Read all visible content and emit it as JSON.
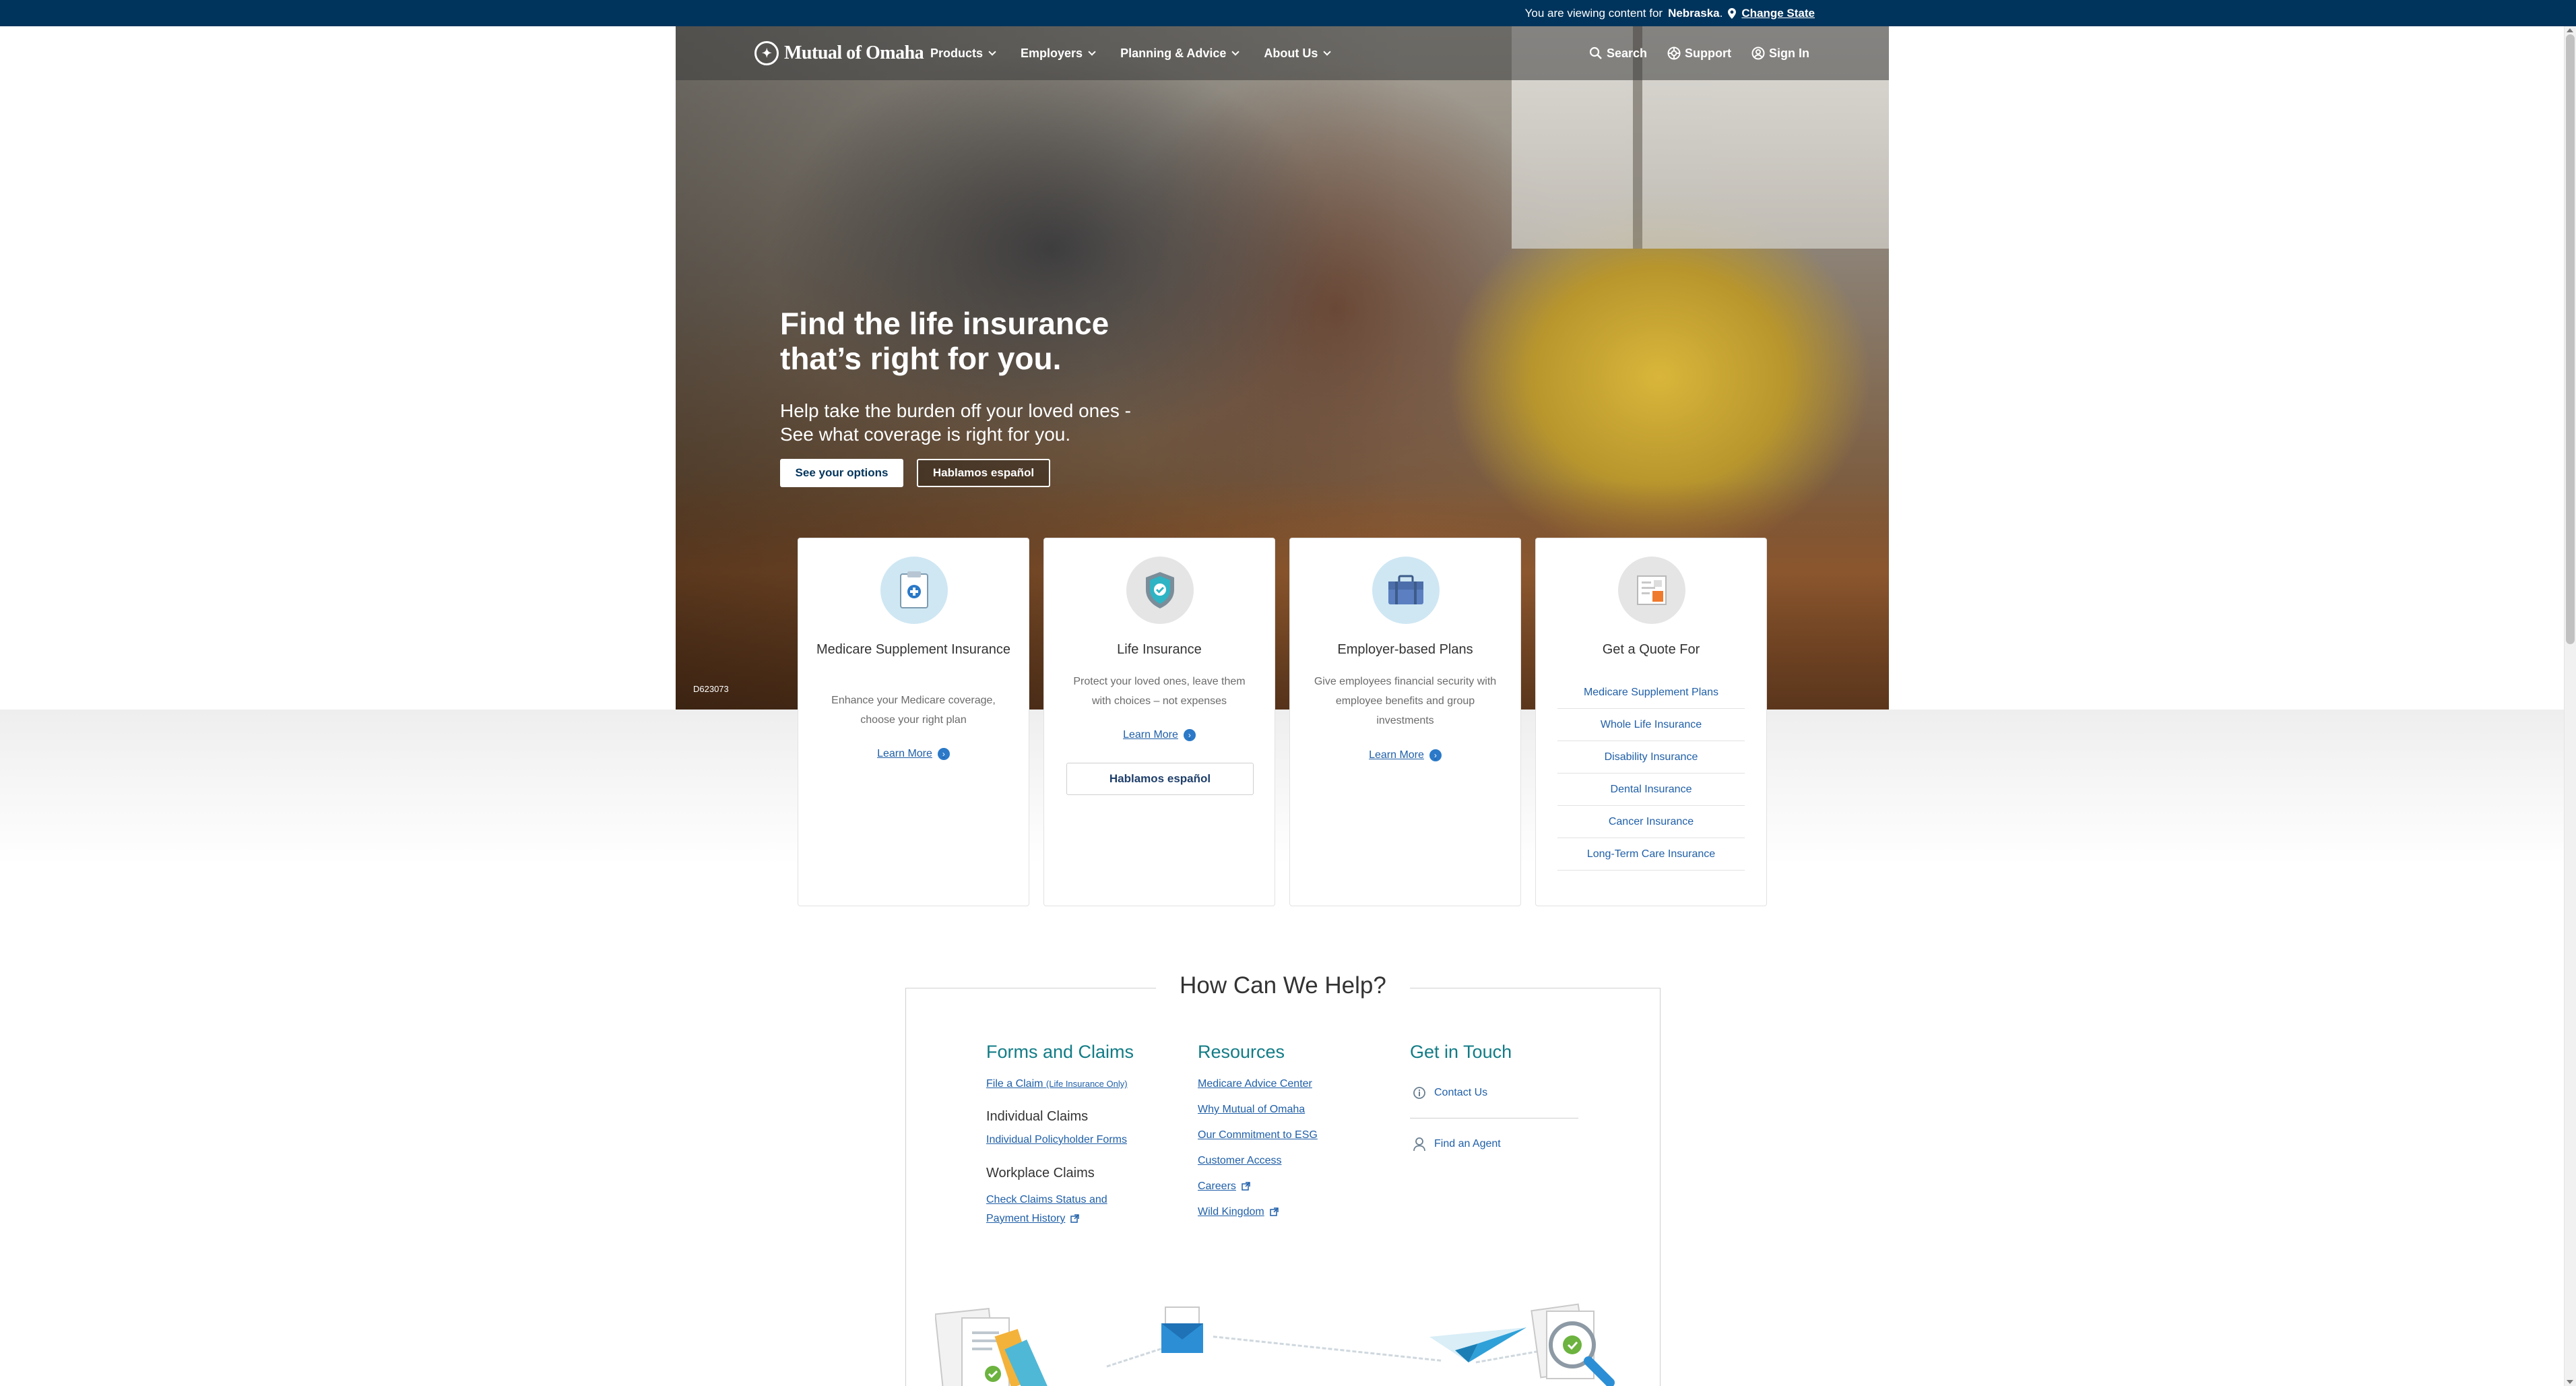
{
  "state_bar": {
    "prefix": "You are viewing content for",
    "state": "Nebraska",
    "suffix": ".",
    "change_label": "Change State"
  },
  "nav": {
    "logo_text": "Mutual of Omaha",
    "links": [
      {
        "label": "Products"
      },
      {
        "label": "Employers"
      },
      {
        "label": "Planning & Advice"
      },
      {
        "label": "About Us"
      }
    ],
    "search_label": "Search",
    "support_label": "Support",
    "signin_label": "Sign In"
  },
  "hero": {
    "title": "Find the life insurance that’s right for you.",
    "subtitle": "Help take the burden off your loved ones - See what coverage is right for you.",
    "primary_button": "See your options",
    "secondary_button": "Hablamos español",
    "image_code": "D623073"
  },
  "cards": [
    {
      "title": "Medicare Supplement Insurance",
      "desc": "Enhance your Medicare coverage, choose your right plan",
      "link": "Learn More",
      "icon": "clipboard-plus-icon"
    },
    {
      "title": "Life Insurance",
      "desc": "Protect your loved ones, leave them with choices – not expenses",
      "link": "Learn More",
      "button": "Hablamos español",
      "icon": "shield-check-icon"
    },
    {
      "title": "Employer-based Plans",
      "desc": "Give employees financial security with employee benefits and group investments",
      "link": "Learn More",
      "icon": "briefcase-icon"
    },
    {
      "title": "Get a Quote For",
      "icon": "quote-form-icon",
      "items": [
        "Medicare Supplement Plans",
        "Whole Life Insurance",
        "Disability Insurance",
        "Dental Insurance",
        "Cancer Insurance",
        "Long-Term Care Insurance"
      ]
    }
  ],
  "help": {
    "title": "How Can We Help?",
    "forms": {
      "heading": "Forms and Claims",
      "file_claim": "File a Claim",
      "file_claim_note": "(Life Insurance Only)",
      "individual_heading": "Individual Claims",
      "individual_link": "Individual Policyholder Forms",
      "workplace_heading": "Workplace Claims",
      "workplace_link_1": "Check Claims Status and",
      "workplace_link_2": "Payment History"
    },
    "resources": {
      "heading": "Resources",
      "links": [
        "Medicare Advice Center",
        "Why Mutual of Omaha",
        "Our Commitment to ESG",
        "Customer Access",
        "Careers",
        "Wild Kingdom"
      ]
    },
    "touch": {
      "heading": "Get in Touch",
      "contact": "Contact Us",
      "agent": "Find an Agent"
    }
  },
  "colors": {
    "navy": "#00345c",
    "teal": "#127c86",
    "link": "#1f5fa8"
  }
}
